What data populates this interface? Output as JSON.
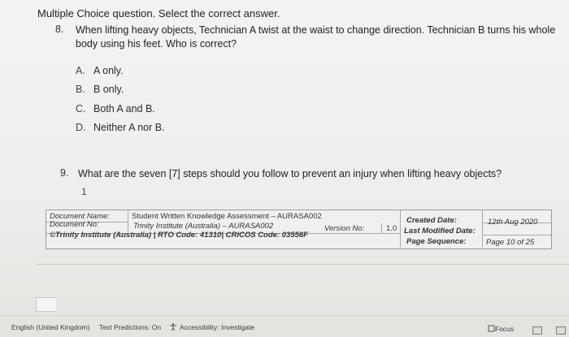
{
  "instruction": "Multiple Choice question. Select the correct answer.",
  "q8": {
    "number": "8.",
    "line1": "When lifting heavy objects, Technician A twist at the waist to change direction. Technician B turns his whole",
    "line2": "body using his feet. Who is correct?",
    "options": [
      {
        "letter": "A.",
        "text": "A only."
      },
      {
        "letter": "B.",
        "text": "B only."
      },
      {
        "letter": "C.",
        "text": "Both A and B."
      },
      {
        "letter": "D.",
        "text": "Neither A nor B."
      }
    ]
  },
  "q9": {
    "number": "9.",
    "text": "What are the seven [7] steps should you follow to prevent an injury when lifting heavy objects?",
    "answer": "1"
  },
  "footer": {
    "doc_name_label": "Document Name:",
    "doc_name_value": "Student Written Knowledge Assessment – AURASA002",
    "doc_no_label": "Document No:",
    "doc_no_value": "Trinity Institute (Australia) – AURASA002",
    "version_label": "Version No:",
    "version_value": "1.0",
    "copyright": "©Trinity Institute (Australia) | RTO Code: 41310| CRICOS Code: 03556F",
    "created_label": "Created Date:",
    "created_value": "12th Aug 2020",
    "modified_label": "Last Modified Date:",
    "sequence_label": "Page Sequence:",
    "sequence_value": "Page 10 of 25"
  },
  "statusbar": {
    "language": "English (United Kingdom)",
    "text_predictions": "Text Predictions: On",
    "accessibility": "Accessibility: Investigate",
    "focus": "Focus"
  }
}
